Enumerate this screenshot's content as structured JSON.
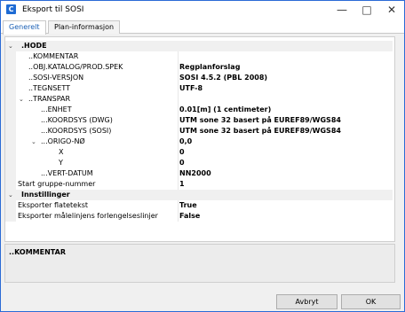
{
  "window": {
    "title": "Eksport til SOSI",
    "app_icon_glyph": "C",
    "minimize_glyph": "—",
    "maximize_glyph": "□",
    "close_glyph": "✕"
  },
  "tabs": [
    {
      "label": "Generelt",
      "selected": true
    },
    {
      "label": "Plan-informasjon",
      "selected": false
    }
  ],
  "grid": {
    "categories": {
      "hode": ".HODE",
      "innstillinger": "Innstillinger"
    },
    "rows": {
      "kommentar": {
        "name": "..KOMMENTAR",
        "value": ""
      },
      "obj_katalog": {
        "name": "..OBJ.KATALOG/PROD.SPEK",
        "value": "Regplanforslag"
      },
      "sosi_versjon": {
        "name": "..SOSI-VERSJON",
        "value": "SOSI 4.5.2 (PBL 2008)"
      },
      "tegnsett": {
        "name": "..TEGNSETT",
        "value": "UTF-8"
      },
      "transpar": {
        "name": "..TRANSPAR",
        "value": ""
      },
      "enhet": {
        "name": "...ENHET",
        "value": "0.01[m] (1 centimeter)"
      },
      "koordsys_dwg": {
        "name": "...KOORDSYS (DWG)",
        "value": "UTM sone 32 basert på EUREF89/WGS84"
      },
      "koordsys_sosi": {
        "name": "...KOORDSYS (SOSI)",
        "value": "UTM sone 32 basert på EUREF89/WGS84"
      },
      "origo": {
        "name": "...ORIGO-NØ",
        "value": "0,0"
      },
      "x": {
        "name": "X",
        "value": "0"
      },
      "y": {
        "name": "Y",
        "value": "0"
      },
      "vert_datum": {
        "name": "...VERT-DATUM",
        "value": "NN2000"
      },
      "start_gruppe": {
        "name": "Start gruppe-nummer",
        "value": "1"
      },
      "flatetekst": {
        "name": "Eksporter flatetekst",
        "value": "True"
      },
      "forlengelseslinjer": {
        "name": "Eksporter målelinjens forlengelseslinjer",
        "value": "False"
      }
    },
    "expanded_glyph": "⌄",
    "collapse_glyph": "⌄"
  },
  "description": {
    "title": "..KOMMENTAR"
  },
  "buttons": {
    "cancel": "Avbryt",
    "ok": "OK"
  }
}
